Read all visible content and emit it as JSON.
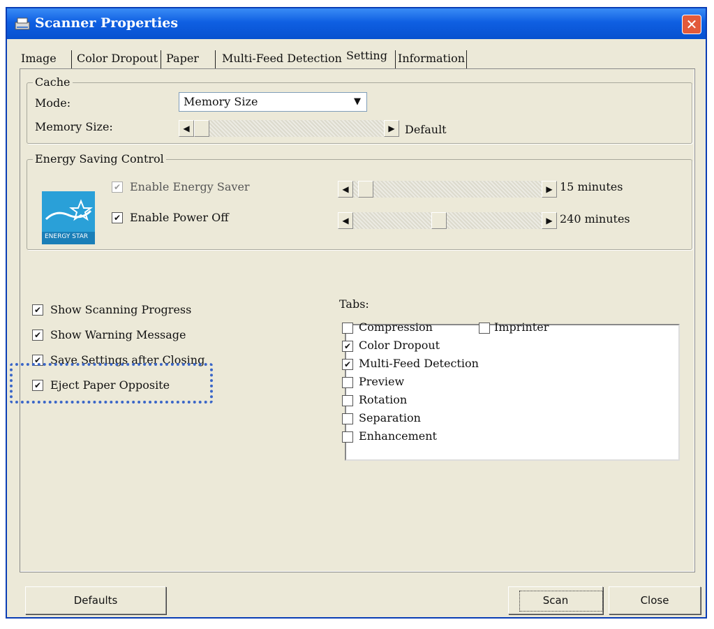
{
  "window": {
    "title": "Scanner Properties",
    "close_symbol": "✕"
  },
  "tabs": [
    {
      "label": "Image"
    },
    {
      "label": "Color Dropout"
    },
    {
      "label": "Paper"
    },
    {
      "label": "Multi-Feed Detection"
    },
    {
      "label": "Setting",
      "active": true
    },
    {
      "label": "Information"
    }
  ],
  "cache": {
    "title": "Cache",
    "mode_label": "Mode:",
    "mode_value": "Memory Size",
    "memory_size_label": "Memory Size:",
    "memory_size_value": "Default",
    "memory_size_level": 0
  },
  "energy": {
    "title": "Energy Saving Control",
    "logo_text": "ENERGY STAR",
    "enable_energy_saver": {
      "label": "Enable Energy Saver",
      "checked": true,
      "disabled": true,
      "value": "15 minutes",
      "level": 0.03
    },
    "enable_power_off": {
      "label": "Enable Power Off",
      "checked": true,
      "disabled": false,
      "value": "240 minutes",
      "level": 0.45
    }
  },
  "options": [
    {
      "label": "Show Scanning Progress",
      "checked": true
    },
    {
      "label": "Show Warning Message",
      "checked": true
    },
    {
      "label": "Save Settings after Closing",
      "checked": true
    },
    {
      "label": "Eject Paper Opposite",
      "checked": true
    }
  ],
  "tabs_list": {
    "label": "Tabs:",
    "items": [
      {
        "label": "Compression",
        "checked": false
      },
      {
        "label": "Imprinter",
        "checked": false
      },
      {
        "label": "Color Dropout",
        "checked": true
      },
      {
        "label": "Multi-Feed Detection",
        "checked": true
      },
      {
        "label": "Preview",
        "checked": false
      },
      {
        "label": "Rotation",
        "checked": false
      },
      {
        "label": "Separation",
        "checked": false
      },
      {
        "label": "Enhancement",
        "checked": false
      }
    ]
  },
  "buttons": {
    "defaults": "Defaults",
    "scan": "Scan",
    "close": "Close"
  },
  "colors": {
    "titlebar": "#0f5fe2",
    "highlight": "#3a66c8",
    "close_button": "#e25a3b"
  }
}
